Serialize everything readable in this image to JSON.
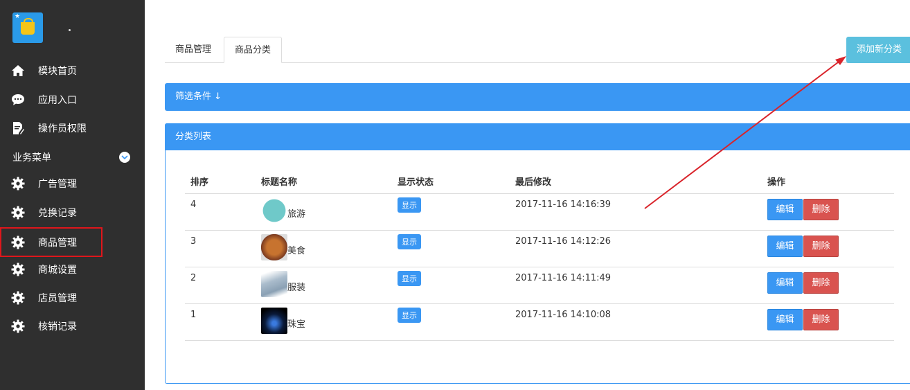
{
  "sidebar": {
    "items": [
      {
        "label": "模块首页",
        "icon": "home-icon"
      },
      {
        "label": "应用入口",
        "icon": "chat-icon"
      },
      {
        "label": "操作员权限",
        "icon": "document-edit-icon"
      }
    ],
    "section_title": "业务菜单",
    "business_items": [
      {
        "label": "广告管理",
        "icon": "gear-icon"
      },
      {
        "label": "兑换记录",
        "icon": "gear-icon"
      },
      {
        "label": "商品管理",
        "icon": "gear-icon",
        "active": true
      },
      {
        "label": "商城设置",
        "icon": "gear-icon"
      },
      {
        "label": "店员管理",
        "icon": "gear-icon"
      },
      {
        "label": "核销记录",
        "icon": "gear-icon"
      }
    ]
  },
  "tabs": [
    {
      "label": "商品管理"
    },
    {
      "label": "商品分类",
      "active": true
    }
  ],
  "add_button": "添加新分类",
  "filter": {
    "label": "筛选条件 ↓"
  },
  "list": {
    "title": "分类列表",
    "columns": [
      "排序",
      "标题名称",
      "显示状态",
      "最后修改",
      "操作"
    ],
    "rows": [
      {
        "order": "4",
        "name": "旅游",
        "status": "显示",
        "modified": "2017-11-16 14:16:39",
        "thumb_color": "#6fc9c9"
      },
      {
        "order": "3",
        "name": "美食",
        "status": "显示",
        "modified": "2017-11-16 14:12:26",
        "thumb_color": "#b5532a"
      },
      {
        "order": "2",
        "name": "服装",
        "status": "显示",
        "modified": "2017-11-16 14:11:49",
        "thumb_color": "#aabccc"
      },
      {
        "order": "1",
        "name": "珠宝",
        "status": "显示",
        "modified": "2017-11-16 14:10:08",
        "thumb_color": "#0a1a3a"
      }
    ],
    "edit_label": "编辑",
    "delete_label": "删除"
  },
  "colors": {
    "sidebar_bg": "#2f2f2f",
    "primary": "#3a97f3",
    "info": "#5bc0de",
    "danger": "#d9534f",
    "highlight": "#e0161b"
  }
}
